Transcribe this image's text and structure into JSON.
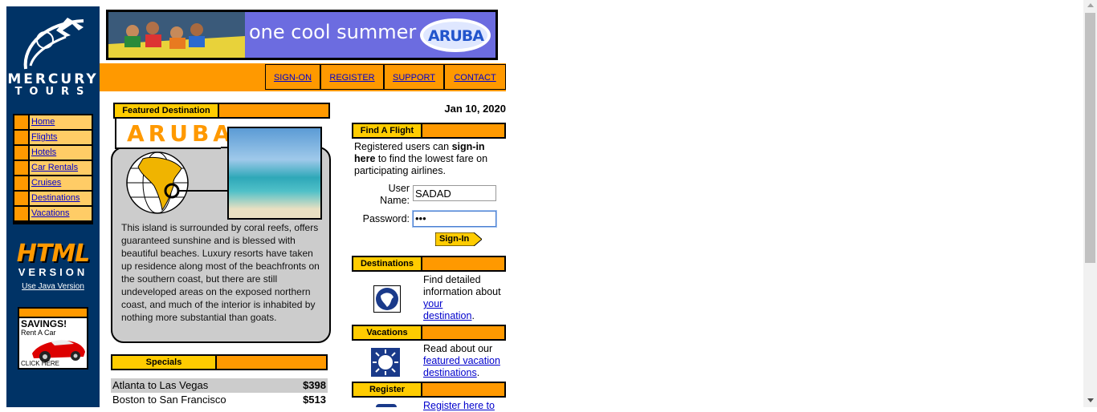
{
  "logo": {
    "line1": "MERCURY",
    "line2": "TOURS"
  },
  "sidebar": {
    "nav": [
      "Home",
      "Flights",
      "Hotels",
      "Car Rentals",
      "Cruises",
      "Destinations",
      "Vacations"
    ],
    "html_version": {
      "line1": "HTML",
      "line2": "VERSION",
      "java_link": "Use Java Version"
    },
    "ad": {
      "title": "SAVINGS!",
      "subtitle": "Rent A Car",
      "cta": "CLICK HERE"
    }
  },
  "banner": {
    "tagline": "one cool summer",
    "brand": "ARUBA"
  },
  "topnav": [
    "SIGN-ON",
    "REGISTER",
    "SUPPORT",
    "CONTACT"
  ],
  "featured": {
    "header": "Featured Destination",
    "name": "ARUBA",
    "description": "This island is surrounded by coral reefs, offers guaranteed sunshine and is blessed with beautiful beaches. Luxury resorts have taken up residence along most of the beachfronts on the southern coast, but there are still undeveloped areas on the exposed northern coast, and much of the interior is inhabited by nothing more substantial than goats."
  },
  "specials": {
    "header": "Specials",
    "rows": [
      {
        "route": "Atlanta to Las Vegas",
        "price": "$398"
      },
      {
        "route": "Boston to San Francisco",
        "price": "$513"
      }
    ]
  },
  "date": "Jan 10, 2020",
  "find_flight": {
    "header": "Find A Flight",
    "intro_pre": "Registered users can ",
    "intro_bold": "sign-in here",
    "intro_post": " to find the lowest fare on participating airlines.",
    "username_label_1": "User",
    "username_label_2": "Name:",
    "username_value": "SADAD",
    "password_label": "Password:",
    "password_value": "•••",
    "signin_button": "Sign-In"
  },
  "destinations": {
    "header": "Destinations",
    "text_pre": "Find detailed information about ",
    "link_1": "your",
    "link_2": "destination",
    "text_post": "."
  },
  "vacations": {
    "header": "Vacations",
    "text_pre": "Read about our ",
    "link_1": "featured vacation",
    "link_2": "destinations",
    "text_post": "."
  },
  "register": {
    "header": "Register",
    "link_text": "Register here to"
  },
  "colors": {
    "navy": "#003366",
    "orange": "#ff9900",
    "gold": "#ffcc00",
    "light_orange": "#ffcc66"
  }
}
